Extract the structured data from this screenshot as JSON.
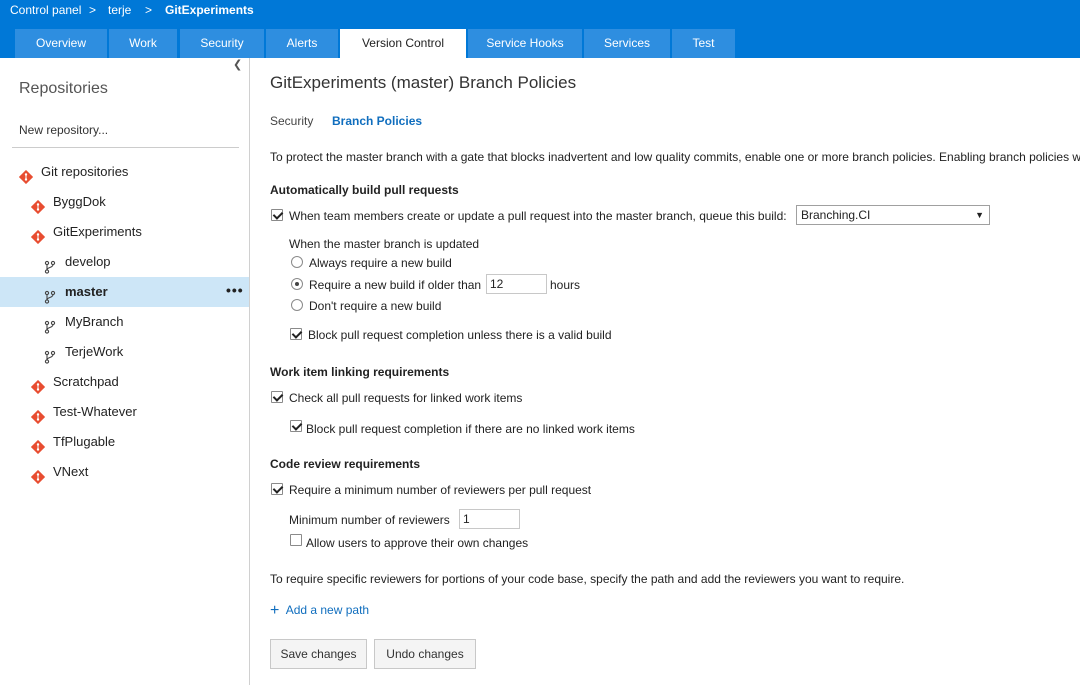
{
  "header": {
    "breadcrumbs": [
      {
        "label": "Control panel"
      },
      {
        "label": "terje"
      },
      {
        "label": "GitExperiments"
      }
    ],
    "separator": ">",
    "tabs": [
      {
        "label": "Overview"
      },
      {
        "label": "Work"
      },
      {
        "label": "Security"
      },
      {
        "label": "Alerts"
      },
      {
        "label": "Version Control",
        "active": true
      },
      {
        "label": "Service Hooks"
      },
      {
        "label": "Services"
      },
      {
        "label": "Test"
      }
    ]
  },
  "sidebar": {
    "collapse_icon": "chevron-left-icon",
    "heading": "Repositories",
    "new_repo": "New repository...",
    "items": [
      {
        "label": "Git repositories",
        "icon": "git-icon"
      },
      {
        "label": "ByggDok",
        "icon": "git-icon"
      },
      {
        "label": "GitExperiments",
        "icon": "git-icon"
      },
      {
        "label": "develop",
        "icon": "branch-icon"
      },
      {
        "label": "master",
        "icon": "branch-icon",
        "selected": true,
        "more": "•••"
      },
      {
        "label": "MyBranch",
        "icon": "branch-icon"
      },
      {
        "label": "TerjeWork",
        "icon": "branch-icon"
      },
      {
        "label": "Scratchpad",
        "icon": "git-icon"
      },
      {
        "label": "Test-Whatever",
        "icon": "git-icon"
      },
      {
        "label": "TfPlugable",
        "icon": "git-icon"
      },
      {
        "label": "VNext",
        "icon": "git-icon"
      }
    ]
  },
  "main": {
    "title": "GitExperiments (master) Branch Policies",
    "subtabs": {
      "security": "Security",
      "branch_policies": "Branch Policies"
    },
    "intro": "To protect the master branch with a gate that blocks inadvertent and low quality commits, enable one or more branch policies. Enabling branch policies w",
    "build": {
      "heading": "Automatically build pull requests",
      "queue_label": "When team members create or update a pull request into the master branch, queue this build:",
      "queue_checked": true,
      "build_select": "Branching.CI",
      "when_updated": "When the master branch is updated",
      "always": "Always require a new build",
      "older_than": "Require a new build if older than",
      "older_than_value": "12",
      "hours": "hours",
      "dont": "Don't require a new build",
      "selected_option": "older_than",
      "block": "Block pull request completion unless there is a valid build",
      "block_checked": true
    },
    "workitems": {
      "heading": "Work item linking requirements",
      "check": "Check all pull requests for linked work items",
      "check_checked": true,
      "block": "Block pull request completion if there are no linked work items",
      "block_checked": true
    },
    "review": {
      "heading": "Code review requirements",
      "require": "Require a minimum number of reviewers per pull request",
      "require_checked": true,
      "min_label": "Minimum number of reviewers",
      "min_value": "1",
      "allow": "Allow users to approve their own changes",
      "allow_checked": false
    },
    "path_note": "To require specific reviewers for portions of your code base, specify the path and add the reviewers you want to require.",
    "add_path": "Add a new path",
    "save": "Save changes",
    "undo": "Undo changes"
  },
  "colors": {
    "brand": "#0078d7",
    "tab": "#2e8ee0",
    "selected": "#cde6f7",
    "link": "#106ebe",
    "git": "#e84d31"
  }
}
